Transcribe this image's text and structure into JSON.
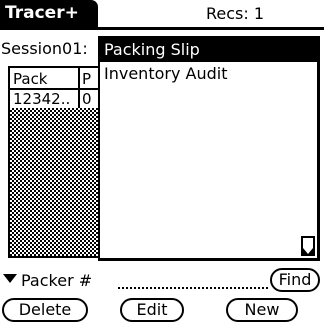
{
  "app": {
    "title": "Tracer+",
    "records": "Recs: 1"
  },
  "session": {
    "label": "Session01:"
  },
  "table": {
    "columns": [
      "Pack..",
      "P"
    ],
    "rows": [
      [
        "12342..",
        "0"
      ]
    ]
  },
  "popup": {
    "items": [
      "Packing Slip",
      "Inventory Audit"
    ],
    "selected": "Packing Slip"
  },
  "packer": {
    "label": "Packer #"
  },
  "buttons": {
    "find": "Find",
    "delete": "Delete",
    "edit": "Edit",
    "new": "New"
  }
}
